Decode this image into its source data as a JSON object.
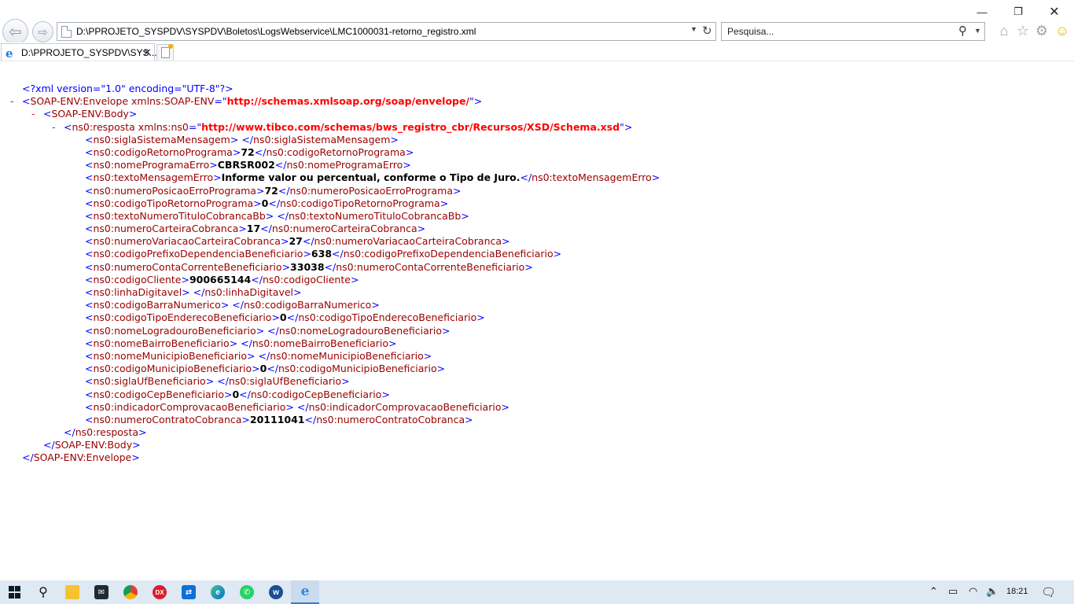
{
  "window": {
    "minimize": "—",
    "maximize": "❐",
    "close": "✕"
  },
  "nav": {
    "back": "⇦",
    "forward": "⇨"
  },
  "address": {
    "url": "D:\\PPROJETO_SYSPDV\\SYSPDV\\Boletos\\LogsWebservice\\LMC1000031-retorno_registro.xml",
    "dropdown": "▼",
    "refresh": "↻"
  },
  "search": {
    "placeholder": "Pesquisa...",
    "dropdown": "▼",
    "icon": "⚲"
  },
  "toolbar_icons": {
    "home": "⌂",
    "favorites": "☆",
    "tools": "⚙",
    "feedback": "☺"
  },
  "tab": {
    "label": "D:\\PPROJETO_SYSPDV\\SYS...",
    "close": "✕",
    "icon": "e"
  },
  "xml": {
    "declaration": "<?xml version=\"1.0\" encoding=\"UTF-8\"?>",
    "toggle": "-",
    "envelope_tag": "SOAP-ENV:Envelope",
    "envelope_attr": "xmlns:SOAP-ENV",
    "envelope_ns": "http://schemas.xmlsoap.org/soap/envelope/",
    "body_tag": "SOAP-ENV:Body",
    "resposta_tag": "ns0:resposta",
    "resposta_attr": "xmlns:ns0",
    "resposta_ns": "http://www.tibco.com/schemas/bws_registro_cbr/Recursos/XSD/Schema.xsd",
    "fields": [
      {
        "tag": "ns0:siglaSistemaMensagem",
        "value": ""
      },
      {
        "tag": "ns0:codigoRetornoPrograma",
        "value": "72"
      },
      {
        "tag": "ns0:nomeProgramaErro",
        "value": "CBRSR002"
      },
      {
        "tag": "ns0:textoMensagemErro",
        "value": "Informe valor ou percentual, conforme o Tipo de Juro."
      },
      {
        "tag": "ns0:numeroPosicaoErroPrograma",
        "value": "72"
      },
      {
        "tag": "ns0:codigoTipoRetornoPrograma",
        "value": "0"
      },
      {
        "tag": "ns0:textoNumeroTituloCobrancaBb",
        "value": ""
      },
      {
        "tag": "ns0:numeroCarteiraCobranca",
        "value": "17"
      },
      {
        "tag": "ns0:numeroVariacaoCarteiraCobranca",
        "value": "27"
      },
      {
        "tag": "ns0:codigoPrefixoDependenciaBeneficiario",
        "value": "638"
      },
      {
        "tag": "ns0:numeroContaCorrenteBeneficiario",
        "value": "33038"
      },
      {
        "tag": "ns0:codigoCliente",
        "value": "900665144"
      },
      {
        "tag": "ns0:linhaDigitavel",
        "value": ""
      },
      {
        "tag": "ns0:codigoBarraNumerico",
        "value": ""
      },
      {
        "tag": "ns0:codigoTipoEnderecoBeneficiario",
        "value": "0"
      },
      {
        "tag": "ns0:nomeLogradouroBeneficiario",
        "value": ""
      },
      {
        "tag": "ns0:nomeBairroBeneficiario",
        "value": ""
      },
      {
        "tag": "ns0:nomeMunicipioBeneficiario",
        "value": ""
      },
      {
        "tag": "ns0:codigoMunicipioBeneficiario",
        "value": "0"
      },
      {
        "tag": "ns0:siglaUfBeneficiario",
        "value": ""
      },
      {
        "tag": "ns0:codigoCepBeneficiario",
        "value": "0"
      },
      {
        "tag": "ns0:indicadorComprovacaoBeneficiario",
        "value": ""
      },
      {
        "tag": "ns0:numeroContratoCobranca",
        "value": "20111041"
      }
    ]
  },
  "taskbar": {
    "apps": [
      {
        "name": "start",
        "glyph": ""
      },
      {
        "name": "search",
        "glyph": "⚲"
      },
      {
        "name": "explorer",
        "glyph": ""
      },
      {
        "name": "mail",
        "glyph": "✉"
      },
      {
        "name": "chrome",
        "glyph": ""
      },
      {
        "name": "dx",
        "glyph": "DX"
      },
      {
        "name": "teamviewer",
        "glyph": "⇄"
      },
      {
        "name": "edge",
        "glyph": "e"
      },
      {
        "name": "whatsapp",
        "glyph": "✆"
      },
      {
        "name": "w",
        "glyph": "w"
      },
      {
        "name": "ie",
        "glyph": "e"
      }
    ],
    "tray": {
      "chevron": "⌃",
      "battery": "▭",
      "wifi": "◠",
      "volume": "🔈"
    },
    "clock": "18:21",
    "notifications": "🗨"
  }
}
